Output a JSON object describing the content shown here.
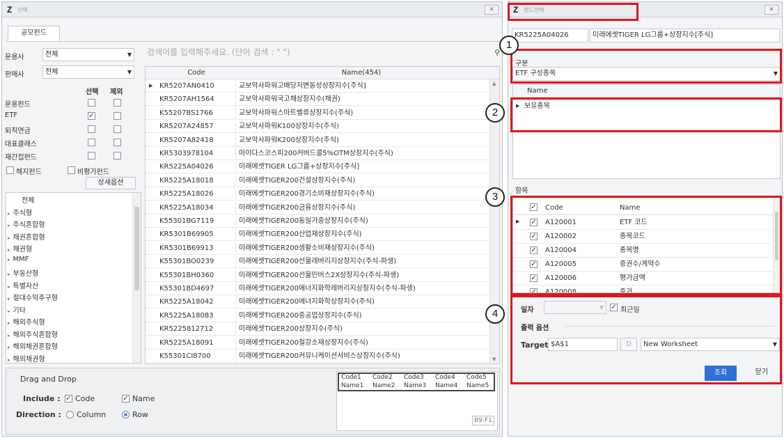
{
  "left_window": {
    "title": "선택",
    "tab": "공모펀드",
    "operator_label": "운용사",
    "operator_value": "전체",
    "seller_label": "판매사",
    "seller_value": "전체",
    "search_placeholder": "검색어를 입력해주세요. (단어 검색 : \" \")",
    "filter_head_select": "선택",
    "filter_head_exclude": "제외",
    "filters": [
      {
        "label": "운용펀드",
        "select": false
      },
      {
        "label": "ETF",
        "select": true
      },
      {
        "label": "퇴직연금",
        "select": false
      },
      {
        "label": "대표클래스",
        "select": false
      },
      {
        "label": "재간접펀드",
        "select": false
      }
    ],
    "hedge_label": "헤지펀드",
    "nontrad_label": "비평가펀드",
    "detail_button": "상세옵션",
    "tree": [
      "전체",
      "주식형",
      "주식혼합형",
      "채권혼합형",
      "채권형",
      "MMF",
      "부동산형",
      "특별자산",
      "절대수익추구형",
      "기타",
      "해외주식형",
      "해외주식혼합형",
      "해외채권혼합형",
      "해외채권형"
    ],
    "table_head_code": "Code",
    "table_head_name": "Name(454)",
    "rows": [
      {
        "code": "KR5207AN0410",
        "name": "교보악사파워고배당저변동성상장지수[주식]"
      },
      {
        "code": "KR5207AH1564",
        "name": "교보악사파워국고채상장지수(채권)"
      },
      {
        "code": "K55207BS1766",
        "name": "교보악사파워스마트벨류상장지수(주식)"
      },
      {
        "code": "KR5207A24857",
        "name": "교보악사파워K100상장지수(주식)"
      },
      {
        "code": "KR5207A82418",
        "name": "교보악사파워K200상장지수(주식)"
      },
      {
        "code": "KR5303978104",
        "name": "마이다스코스피200커버드콜5%OTM상장지수(주식)"
      },
      {
        "code": "KR5225A04026",
        "name": "미래에셋TIGER LG그룹+상장지수[주식]"
      },
      {
        "code": "KR5225A18018",
        "name": "미래에셋TIGER200건설상장지수(주식)"
      },
      {
        "code": "KR5225A18026",
        "name": "미래에셋TIGER200경기소비재상장지수(주식)"
      },
      {
        "code": "KR5225A18034",
        "name": "미래에셋TIGER200금융상장지수(주식)"
      },
      {
        "code": "K55301BG7119",
        "name": "미래에셋TIGER200동일가중상장지수(주식)"
      },
      {
        "code": "KR5301B69905",
        "name": "미래에셋TIGER200산업재상장지수(주식)"
      },
      {
        "code": "KR5301B69913",
        "name": "미래에셋TIGER200생활소비재상장지수(주식)"
      },
      {
        "code": "K55301BO0239",
        "name": "미래에셋TIGER200선물레버리지상장지수(주식-파생)"
      },
      {
        "code": "K55301BH0360",
        "name": "미래에셋TIGER200선물인버스2X상장지수(주식-파생)"
      },
      {
        "code": "K55301BD4697",
        "name": "미래에셋TIGER200에너지화학레버리지상장지수(주식-파생)"
      },
      {
        "code": "KR5225A18042",
        "name": "미래에셋TIGER200에너지화학상장지수(주식)"
      },
      {
        "code": "KR5225A18083",
        "name": "미래에셋TIGER200중공업상장지수(주식)"
      },
      {
        "code": "KR5225812712",
        "name": "미래에셋TIGER200상장지수(주식)"
      },
      {
        "code": "KR5225A18091",
        "name": "미래에셋TIGER200철강소재상장지수(주식)"
      },
      {
        "code": "K55301CI8700",
        "name": "미래에셋TIGER200커뮤니케이션서비스상장지수(주식)"
      }
    ],
    "dnd_title": "Drag and Drop",
    "include_label": "Include :",
    "include_code": "Code",
    "include_name": "Name",
    "direction_label": "Direction :",
    "dir_column": "Column",
    "dir_row": "Row",
    "preview_codes": [
      "Code1",
      "Code2",
      "Code3",
      "Code4",
      "Code5"
    ],
    "preview_names": [
      "Name1",
      "Name2",
      "Name3",
      "Name4",
      "Name5"
    ],
    "preview_cell": "B9:F1"
  },
  "right_window": {
    "title": "펀드선택",
    "fund_code": "KR5225A04026",
    "fund_name": "미래에셋TIGER LG그룹+상장지수[주식]",
    "section_label": "구분",
    "section_value": "ETF 구성종목",
    "name_head": "Name",
    "name_row": "보유종목",
    "items_label": "항목",
    "items_head_code": "Code",
    "items_head_name": "Name",
    "items": [
      {
        "code": "A120001",
        "name": "ETF 코드"
      },
      {
        "code": "A120002",
        "name": "종목코드"
      },
      {
        "code": "A120004",
        "name": "종목명"
      },
      {
        "code": "A120005",
        "name": "증권수/계약수"
      },
      {
        "code": "A120006",
        "name": "평가금액"
      },
      {
        "code": "A120008",
        "name": "증가"
      }
    ],
    "date_label": "일자",
    "recent_label": "최근일",
    "output_label": "출력 옵션",
    "target_label": "Target",
    "target_value": "$A$1",
    "target_btn": "D",
    "sheet_value": "New Worksheet",
    "search_btn": "조회",
    "close_btn": "닫기"
  },
  "badges": [
    "1",
    "2",
    "3",
    "4"
  ],
  "colors": {
    "annotation": "#e0161b",
    "primary_button": "#2e6fd8"
  }
}
